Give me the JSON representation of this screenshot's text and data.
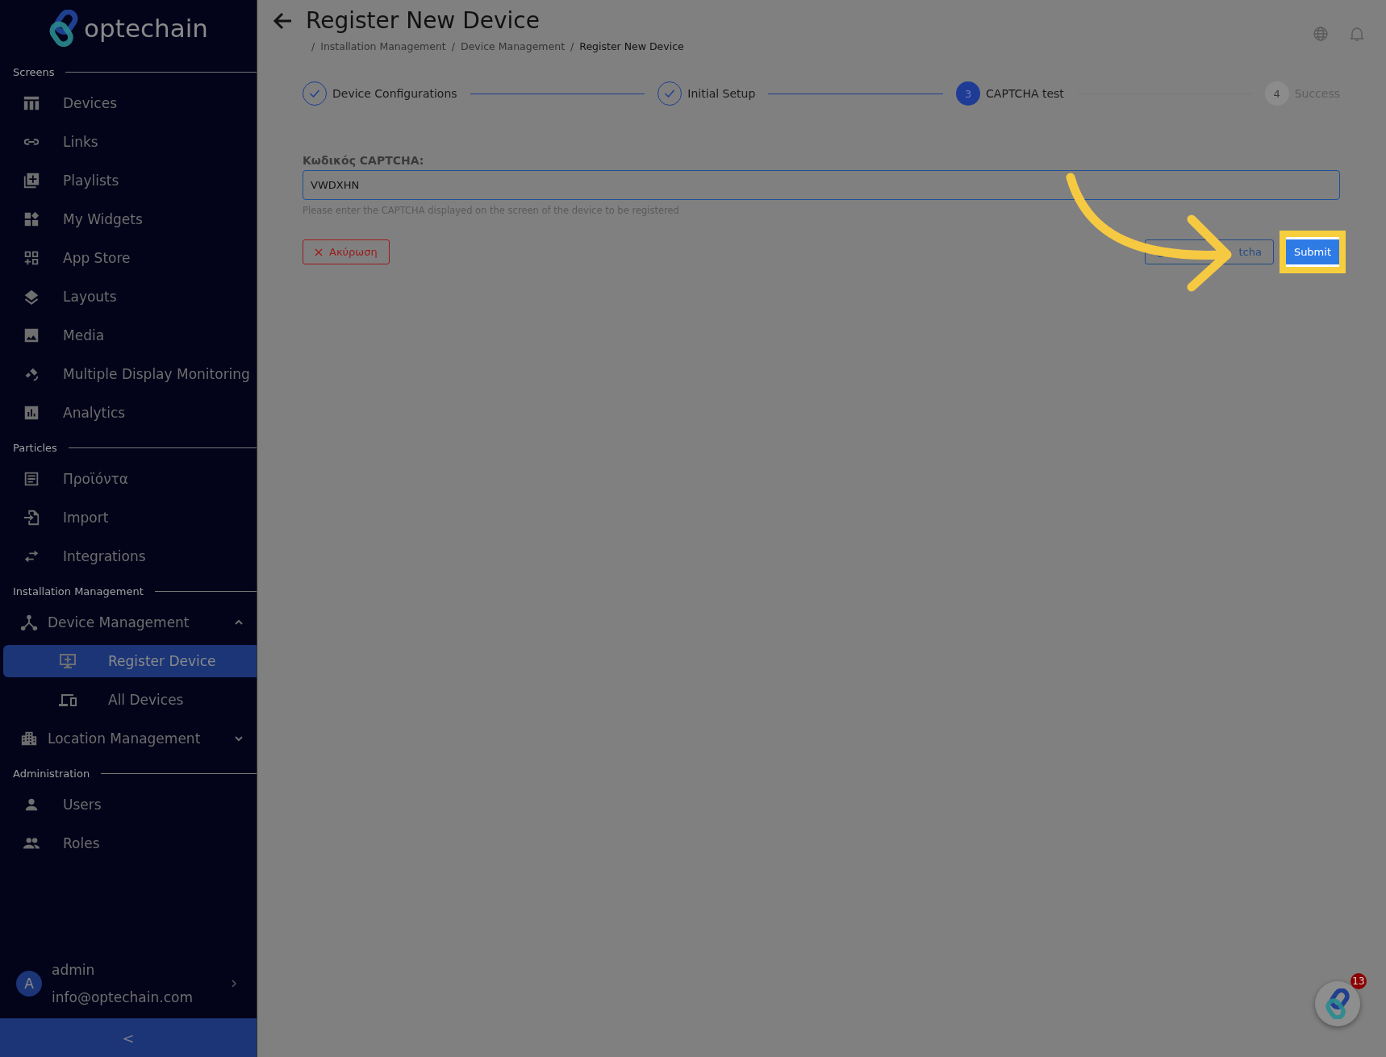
{
  "logo": {
    "text": "optechain"
  },
  "sidebar": {
    "sections": [
      {
        "title": "Screens",
        "items": [
          {
            "label": "Devices",
            "selected": false
          },
          {
            "label": "Links",
            "selected": false
          },
          {
            "label": "Playlists",
            "selected": false
          },
          {
            "label": "My Widgets",
            "selected": false
          },
          {
            "label": "App Store",
            "selected": false
          },
          {
            "label": "Layouts",
            "selected": false
          },
          {
            "label": "Media",
            "selected": false
          },
          {
            "label": "Multiple Display Monitoring",
            "selected": false
          },
          {
            "label": "Analytics",
            "selected": false
          }
        ]
      },
      {
        "title": "Particles",
        "items": [
          {
            "label": "Προϊόντα",
            "selected": false
          },
          {
            "label": "Import",
            "selected": false
          },
          {
            "label": "Integrations",
            "selected": false
          }
        ]
      },
      {
        "title": "Installation Management",
        "items": [
          {
            "label": "Device Management",
            "selected": false,
            "expanded": true,
            "children": [
              {
                "label": "Register Device",
                "selected": true
              },
              {
                "label": "All Devices",
                "selected": false
              }
            ]
          },
          {
            "label": "Location Management",
            "selected": false,
            "expanded": false
          }
        ]
      },
      {
        "title": "Administration",
        "items": [
          {
            "label": "Users",
            "selected": false
          },
          {
            "label": "Roles",
            "selected": false
          }
        ]
      }
    ],
    "user": {
      "initial": "A",
      "name": "admin",
      "email": "info@optechain.com"
    },
    "collapse": "<"
  },
  "header": {
    "title": "Register New Device",
    "separator": "/",
    "breadcrumb": [
      "Installation Management",
      "Device Management",
      "Register New Device"
    ]
  },
  "stepper": [
    {
      "label": "Device Configurations",
      "completed": true,
      "selected": false
    },
    {
      "label": "Initial Setup",
      "completed": true,
      "selected": false
    },
    {
      "label": "CAPTCHA test",
      "completed": false,
      "selected": true,
      "number": "3"
    },
    {
      "label": "Success",
      "completed": false,
      "selected": false,
      "number": "4"
    }
  ],
  "form": {
    "label": "Κωδικός CAPTCHA:",
    "value": "VWDXHN",
    "hint": "Please enter the CAPTCHA displayed on the screen of the device to be registered",
    "cancel": "Ακύρωση",
    "refresh": "tcha",
    "submit": "Submit"
  },
  "help": {
    "badge": "13"
  }
}
